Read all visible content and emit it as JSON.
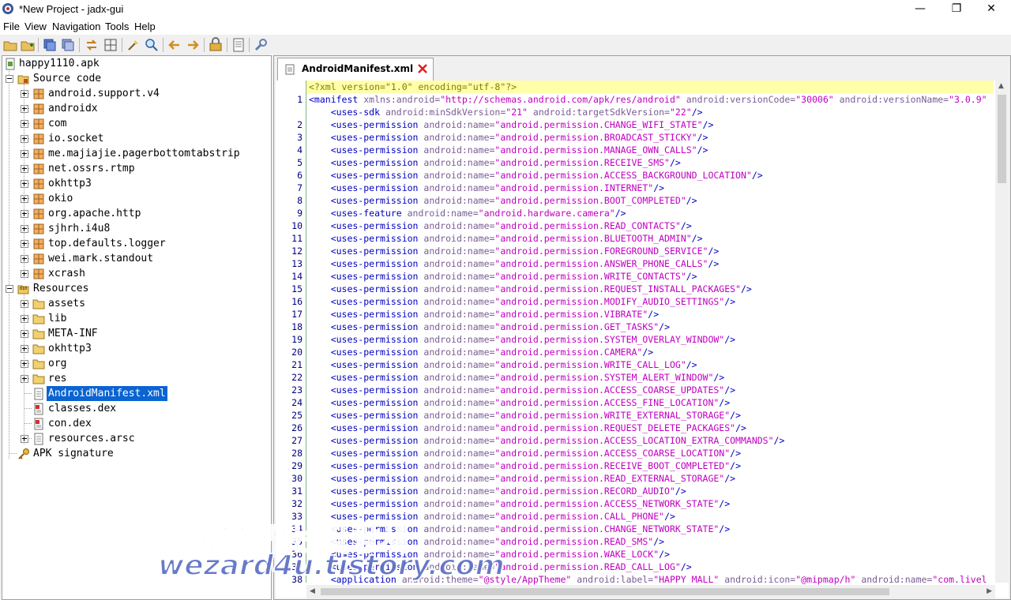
{
  "window": {
    "title": "*New Project - jadx-gui",
    "minimize": "—",
    "maximize": "❐",
    "close": "✕"
  },
  "menu": [
    "File",
    "View",
    "Navigation",
    "Tools",
    "Help"
  ],
  "tree": {
    "root": "happy1110.apk",
    "source_code": "Source code",
    "packages": [
      "android.support.v4",
      "androidx",
      "com",
      "io.socket",
      "me.majiajie.pagerbottomtabstrip",
      "net.ossrs.rtmp",
      "okhttp3",
      "okio",
      "org.apache.http",
      "sjhrh.i4u8",
      "top.defaults.logger",
      "wei.mark.standout",
      "xcrash"
    ],
    "resources": "Resources",
    "resource_folders": [
      "assets",
      "lib",
      "META-INF",
      "okhttp3",
      "org",
      "res"
    ],
    "resource_files": [
      "AndroidManifest.xml",
      "classes.dex",
      "con.dex",
      "resources.arsc"
    ],
    "selected": "AndroidManifest.xml",
    "apk_signature": "APK signature"
  },
  "tab": {
    "label": "AndroidManifest.xml"
  },
  "code": {
    "lines": [
      {
        "n": "",
        "parts": [
          [
            "pi",
            "<?xml version=\"1.0\" encoding=\"utf-8\"?>"
          ]
        ]
      },
      {
        "n": "1",
        "parts": [
          [
            "t",
            "<manifest "
          ],
          [
            "a",
            "xmlns:android="
          ],
          [
            "v",
            "\"http://schemas.android.com/apk/res/android\" "
          ],
          [
            "a",
            "android:versionCode="
          ],
          [
            "v",
            "\"30006\" "
          ],
          [
            "a",
            "android:versionName="
          ],
          [
            "v",
            "\"3.0.9\""
          ]
        ]
      },
      {
        "n": "",
        "parts": [
          [
            "t",
            "    <uses-sdk "
          ],
          [
            "a",
            "android:minSdkVersion="
          ],
          [
            "v",
            "\"21\" "
          ],
          [
            "a",
            "android:targetSdkVersion="
          ],
          [
            "v",
            "\"22\""
          ],
          [
            "t",
            "/>"
          ]
        ]
      },
      {
        "n": "2",
        "perm": "android.permission.CHANGE_WIFI_STATE"
      },
      {
        "n": "3",
        "perm": "android.permission.BROADCAST_STICKY"
      },
      {
        "n": "4",
        "perm": "android.permission.MANAGE_OWN_CALLS"
      },
      {
        "n": "5",
        "perm": "android.permission.RECEIVE_SMS"
      },
      {
        "n": "6",
        "perm": "android.permission.ACCESS_BACKGROUND_LOCATION"
      },
      {
        "n": "7",
        "perm": "android.permission.INTERNET"
      },
      {
        "n": "8",
        "perm": "android.permission.BOOT_COMPLETED"
      },
      {
        "n": "9",
        "parts": [
          [
            "t",
            "    <uses-feature "
          ],
          [
            "a",
            "android:name="
          ],
          [
            "v",
            "\"android.hardware.camera\""
          ],
          [
            "t",
            "/>"
          ]
        ]
      },
      {
        "n": "10",
        "perm": "android.permission.READ_CONTACTS"
      },
      {
        "n": "11",
        "perm": "android.permission.BLUETOOTH_ADMIN"
      },
      {
        "n": "12",
        "perm": "android.permission.FOREGROUND_SERVICE"
      },
      {
        "n": "13",
        "perm": "android.permission.ANSWER_PHONE_CALLS"
      },
      {
        "n": "14",
        "perm": "android.permission.WRITE_CONTACTS"
      },
      {
        "n": "15",
        "perm": "android.permission.REQUEST_INSTALL_PACKAGES"
      },
      {
        "n": "16",
        "perm": "android.permission.MODIFY_AUDIO_SETTINGS"
      },
      {
        "n": "17",
        "perm": "android.permission.VIBRATE"
      },
      {
        "n": "18",
        "perm": "android.permission.GET_TASKS"
      },
      {
        "n": "19",
        "perm": "android.permission.SYSTEM_OVERLAY_WINDOW"
      },
      {
        "n": "20",
        "perm": "android.permission.CAMERA"
      },
      {
        "n": "21",
        "perm": "android.permission.WRITE_CALL_LOG"
      },
      {
        "n": "22",
        "perm": "android.permission.SYSTEM_ALERT_WINDOW"
      },
      {
        "n": "23",
        "perm": "android.permission.ACCESS_COARSE_UPDATES"
      },
      {
        "n": "24",
        "perm": "android.permission.ACCESS_FINE_LOCATION"
      },
      {
        "n": "25",
        "perm": "android.permission.WRITE_EXTERNAL_STORAGE"
      },
      {
        "n": "26",
        "perm": "android.permission.REQUEST_DELETE_PACKAGES"
      },
      {
        "n": "27",
        "perm": "android.permission.ACCESS_LOCATION_EXTRA_COMMANDS"
      },
      {
        "n": "28",
        "perm": "android.permission.ACCESS_COARSE_LOCATION"
      },
      {
        "n": "29",
        "perm": "android.permission.RECEIVE_BOOT_COMPLETED"
      },
      {
        "n": "30",
        "perm": "android.permission.READ_EXTERNAL_STORAGE"
      },
      {
        "n": "31",
        "perm": "android.permission.RECORD_AUDIO"
      },
      {
        "n": "32",
        "perm": "android.permission.ACCESS_NETWORK_STATE"
      },
      {
        "n": "33",
        "perm": "android.permission.CALL_PHONE"
      },
      {
        "n": "34",
        "perm": "android.permission.CHANGE_NETWORK_STATE"
      },
      {
        "n": "35",
        "perm": "android.permission.READ_SMS"
      },
      {
        "n": "36",
        "perm": "android.permission.WAKE_LOCK"
      },
      {
        "n": "37",
        "perm": "android.permission.READ_CALL_LOG"
      },
      {
        "n": "38",
        "parts": [
          [
            "t",
            "    <application "
          ],
          [
            "a",
            "android:theme="
          ],
          [
            "v",
            "\"@style/AppTheme\" "
          ],
          [
            "a",
            "android:label="
          ],
          [
            "v",
            "\"HAPPY MALL\" "
          ],
          [
            "a",
            "android:icon="
          ],
          [
            "v",
            "\"@mipmap/h\" "
          ],
          [
            "a",
            "android:name="
          ],
          [
            "v",
            "\"com.livel"
          ]
        ]
      }
    ],
    "perm_tag": "    <uses-permission ",
    "perm_attr": "android:name=",
    "perm_close": "/>"
  },
  "watermark": {
    "line1": "꿈을 꾸는파랑새",
    "line2": "wezard4u.tistory.com"
  },
  "colors": {
    "selection": "#0a64d2",
    "highlight_line": "#ffffaa",
    "tag": "#0000c0",
    "attr": "#7a5c93",
    "value": "#c000c0"
  }
}
